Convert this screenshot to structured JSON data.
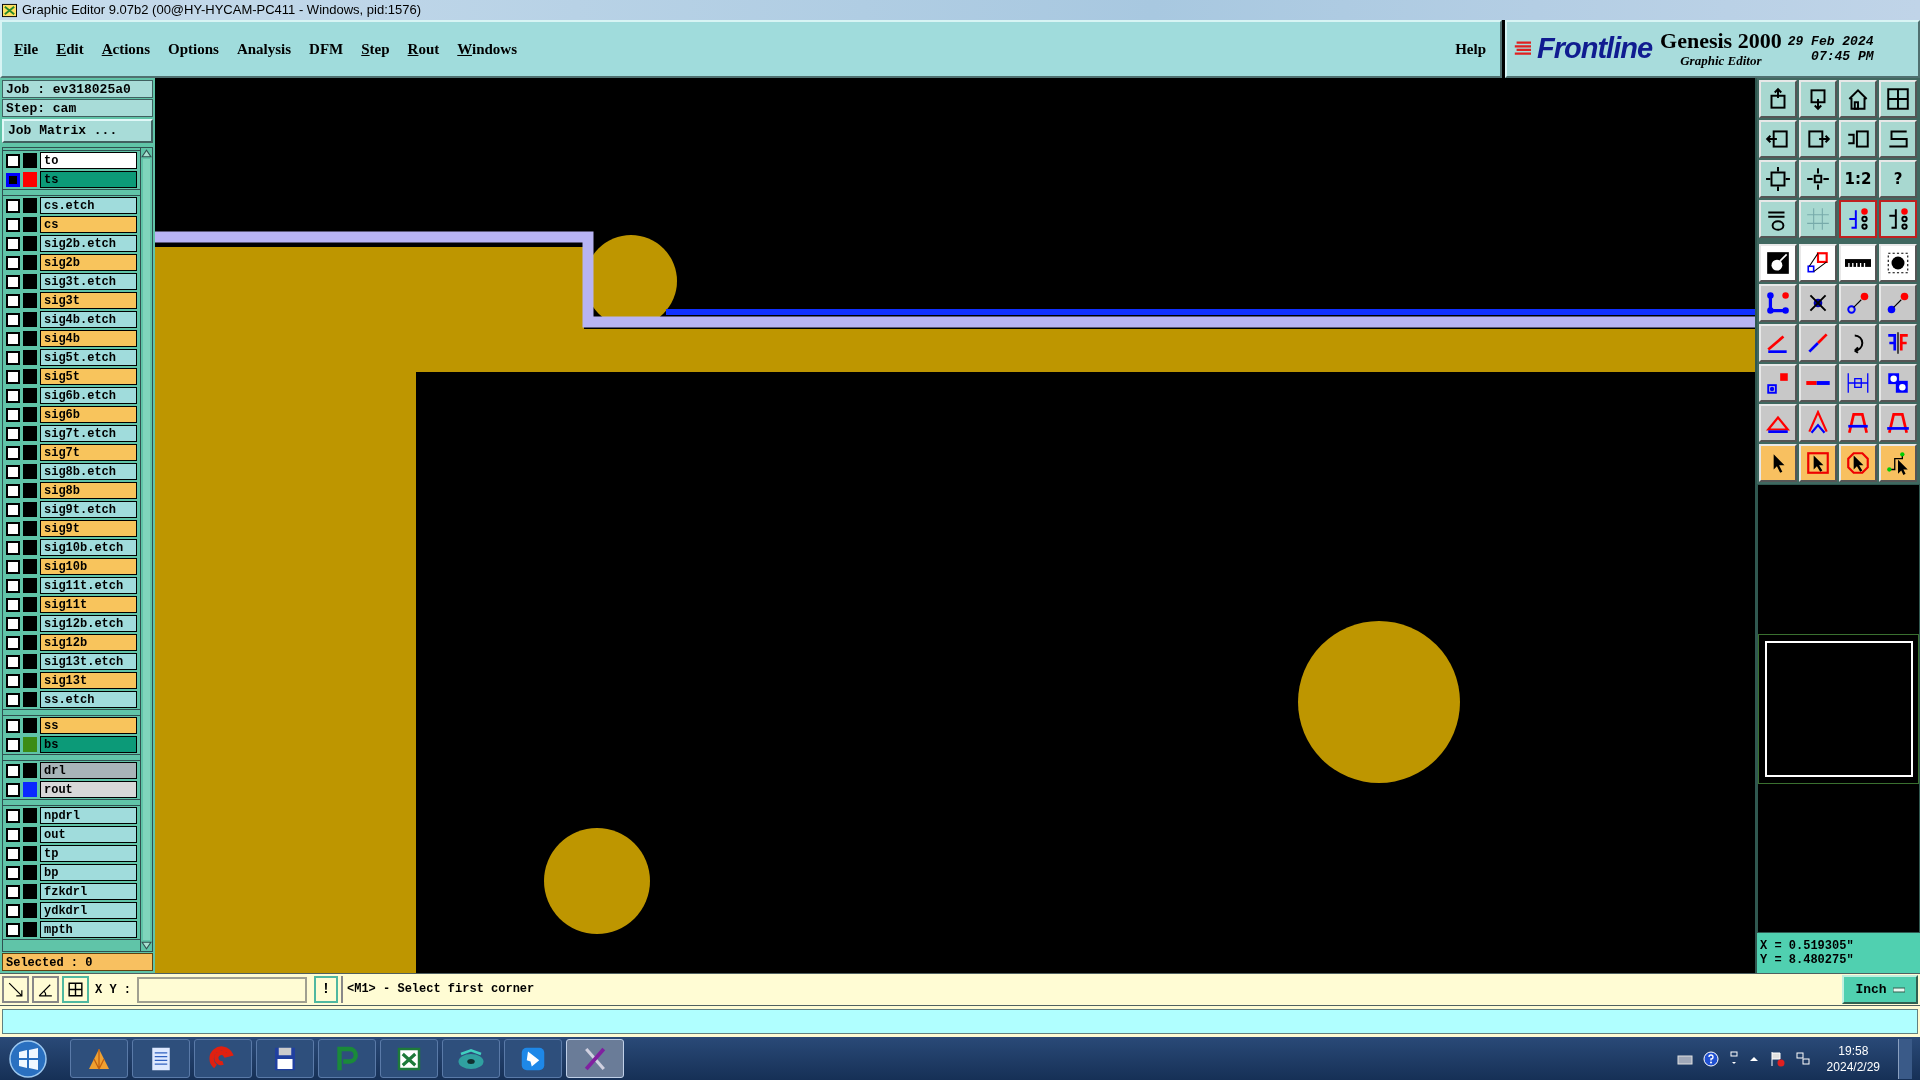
{
  "window": {
    "title": "Graphic Editor 9.07b2 (00@HY-HYCAM-PC411 - Windows, pid:1576)"
  },
  "menu": [
    {
      "label": "File",
      "mnemonic": true
    },
    {
      "label": "Edit",
      "mnemonic": true
    },
    {
      "label": "Actions",
      "mnemonic": true
    },
    {
      "label": "Options",
      "mnemonic": false
    },
    {
      "label": "Analysis",
      "mnemonic": false
    },
    {
      "label": "DFM",
      "mnemonic": false
    },
    {
      "label": "Step",
      "mnemonic": true
    },
    {
      "label": "Rout",
      "mnemonic": true
    },
    {
      "label": "Windows",
      "mnemonic": true
    }
  ],
  "help": "Help",
  "brand": {
    "logo": "Frontline",
    "product": "Genesis 2000",
    "subtitle": "Graphic Editor",
    "date": "29 Feb 2024",
    "time": "07:45 PM"
  },
  "job": {
    "job": "Job : ev318025a0",
    "step": "Step: cam",
    "matrix_button": "Job Matrix ...",
    "selected": "Selected : 0"
  },
  "layer_groups": [
    [
      {
        "name": "to",
        "kind": "board",
        "selected": false
      },
      {
        "name": "ts",
        "kind": "mask",
        "selected": true,
        "color": "#ff0000"
      }
    ],
    [
      {
        "name": "cs.etch",
        "kind": "etch",
        "selected": false
      },
      {
        "name": "cs",
        "kind": "signal",
        "selected": false
      },
      {
        "name": "sig2b.etch",
        "kind": "etch",
        "selected": false
      },
      {
        "name": "sig2b",
        "kind": "signal",
        "selected": false
      },
      {
        "name": "sig3t.etch",
        "kind": "etch",
        "selected": false
      },
      {
        "name": "sig3t",
        "kind": "signal",
        "selected": false
      },
      {
        "name": "sig4b.etch",
        "kind": "etch",
        "selected": false
      },
      {
        "name": "sig4b",
        "kind": "signal",
        "selected": false
      },
      {
        "name": "sig5t.etch",
        "kind": "etch",
        "selected": false
      },
      {
        "name": "sig5t",
        "kind": "signal",
        "selected": false
      },
      {
        "name": "sig6b.etch",
        "kind": "etch",
        "selected": false
      },
      {
        "name": "sig6b",
        "kind": "signal",
        "selected": false
      },
      {
        "name": "sig7t.etch",
        "kind": "etch",
        "selected": false
      },
      {
        "name": "sig7t",
        "kind": "signal",
        "selected": false
      },
      {
        "name": "sig8b.etch",
        "kind": "etch",
        "selected": false
      },
      {
        "name": "sig8b",
        "kind": "signal",
        "selected": false
      },
      {
        "name": "sig9t.etch",
        "kind": "etch",
        "selected": false
      },
      {
        "name": "sig9t",
        "kind": "signal",
        "selected": false
      },
      {
        "name": "sig10b.etch",
        "kind": "etch",
        "selected": false
      },
      {
        "name": "sig10b",
        "kind": "signal",
        "selected": false
      },
      {
        "name": "sig11t.etch",
        "kind": "etch",
        "selected": false
      },
      {
        "name": "sig11t",
        "kind": "signal",
        "selected": false
      },
      {
        "name": "sig12b.etch",
        "kind": "etch",
        "selected": false
      },
      {
        "name": "sig12b",
        "kind": "signal",
        "selected": false
      },
      {
        "name": "sig13t.etch",
        "kind": "etch",
        "selected": false
      },
      {
        "name": "sig13t",
        "kind": "signal",
        "selected": false
      },
      {
        "name": "ss.etch",
        "kind": "etch",
        "selected": false
      }
    ],
    [
      {
        "name": "ss",
        "kind": "signal",
        "selected": false
      },
      {
        "name": "bs",
        "kind": "mask",
        "selected": false,
        "color": "#3c8c14"
      }
    ],
    [
      {
        "name": "drl",
        "kind": "drill",
        "selected": false
      },
      {
        "name": "rout",
        "kind": "rout",
        "selected": false,
        "color": "#0a28ff"
      }
    ],
    [
      {
        "name": "npdrl",
        "kind": "etch",
        "selected": false
      },
      {
        "name": "out",
        "kind": "etch",
        "selected": false
      },
      {
        "name": "tp",
        "kind": "etch",
        "selected": false
      },
      {
        "name": "bp",
        "kind": "etch",
        "selected": false
      },
      {
        "name": "fzkdrl",
        "kind": "etch",
        "selected": false
      },
      {
        "name": "ydkdrl",
        "kind": "etch",
        "selected": false
      },
      {
        "name": "mpth",
        "kind": "etch",
        "selected": false
      }
    ]
  ],
  "tool_rows": [
    [
      {
        "kind": "view",
        "on": false
      },
      {
        "kind": "view",
        "on": false
      },
      {
        "kind": "view",
        "on": false
      },
      {
        "kind": "view",
        "on": false
      }
    ],
    [
      {
        "kind": "view",
        "on": false
      },
      {
        "kind": "view",
        "on": false
      },
      {
        "kind": "view",
        "on": false
      },
      {
        "kind": "view",
        "on": false
      }
    ],
    [
      {
        "kind": "view",
        "on": false
      },
      {
        "kind": "view",
        "on": false
      },
      {
        "kind": "view",
        "on": false,
        "label": "1:2"
      },
      {
        "kind": "view",
        "on": false,
        "label": "?"
      }
    ],
    [
      {
        "kind": "view",
        "on": false
      },
      {
        "kind": "view",
        "on": false
      },
      {
        "kind": "view",
        "on": true
      },
      {
        "kind": "view",
        "on": true
      }
    ],
    [
      {
        "kind": "measure",
        "on": false
      },
      {
        "kind": "measure",
        "on": false
      },
      {
        "kind": "measure",
        "on": false
      },
      {
        "kind": "measure",
        "on": false
      }
    ],
    [
      {
        "kind": "edit",
        "on": false
      },
      {
        "kind": "edit",
        "on": false
      },
      {
        "kind": "edit",
        "on": false
      },
      {
        "kind": "edit",
        "on": false
      }
    ],
    [
      {
        "kind": "edit",
        "on": false
      },
      {
        "kind": "edit",
        "on": false
      },
      {
        "kind": "edit",
        "on": false
      },
      {
        "kind": "edit",
        "on": false
      }
    ],
    [
      {
        "kind": "edit",
        "on": false
      },
      {
        "kind": "edit",
        "on": false
      },
      {
        "kind": "edit",
        "on": false
      },
      {
        "kind": "edit",
        "on": false
      }
    ],
    [
      {
        "kind": "edit",
        "on": false
      },
      {
        "kind": "edit",
        "on": false
      },
      {
        "kind": "edit",
        "on": false
      },
      {
        "kind": "edit",
        "on": false
      }
    ],
    [
      {
        "kind": "select",
        "on": false
      },
      {
        "kind": "select",
        "on": false
      },
      {
        "kind": "select",
        "on": false
      },
      {
        "kind": "select",
        "on": false
      }
    ]
  ],
  "coordinates": {
    "x": "X = 0.519305\"",
    "y": "Y = 8.480275\""
  },
  "command_bar": {
    "xy_label": "X Y :",
    "alert_button": "!",
    "prompt": "<M1> - Select first corner",
    "units": "Inch"
  },
  "taskbar": {
    "apps": [
      {
        "selected": false
      },
      {
        "selected": false
      },
      {
        "selected": false
      },
      {
        "selected": false
      },
      {
        "selected": false
      },
      {
        "selected": false
      },
      {
        "selected": false
      },
      {
        "selected": false
      },
      {
        "selected": true
      }
    ],
    "time": "19:58",
    "date": "2024/2/29"
  }
}
